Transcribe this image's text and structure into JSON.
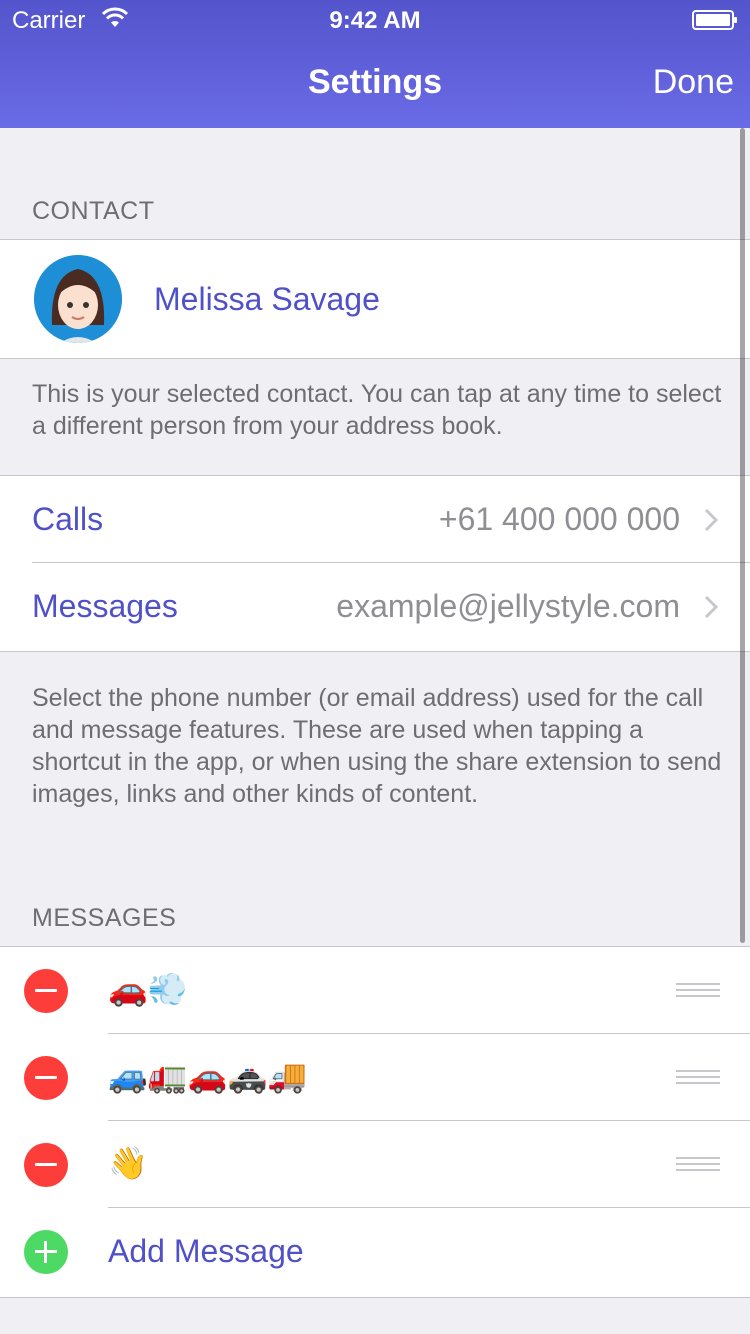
{
  "status_bar": {
    "carrier": "Carrier",
    "time": "9:42 AM"
  },
  "nav": {
    "title": "Settings",
    "done_label": "Done"
  },
  "contact_section": {
    "header": "CONTACT",
    "name": "Melissa Savage",
    "footer": "This is your selected contact. You can tap at any time to select a different person from your address book."
  },
  "channels": {
    "rows": [
      {
        "label": "Calls",
        "value": "+61 400 000 000"
      },
      {
        "label": "Messages",
        "value": "example@jellystyle.com"
      }
    ],
    "footer": "Select the phone number (or email address) used for the call and message features. These are used when tapping a shortcut in the app, or when using the share extension to send images, links and other kinds of content."
  },
  "messages_section": {
    "header": "MESSAGES",
    "items": [
      {
        "text": "🚗💨"
      },
      {
        "text": "🚙🚛🚗🚓🚚"
      },
      {
        "text": "👋"
      }
    ],
    "add_label": "Add Message"
  },
  "colors": {
    "accent": "#5051c9",
    "nav_gradient_top": "#5454cc",
    "nav_gradient_bottom": "#6a6be6",
    "delete": "#fc3d39",
    "add": "#4cd964",
    "background": "#efeff4"
  }
}
